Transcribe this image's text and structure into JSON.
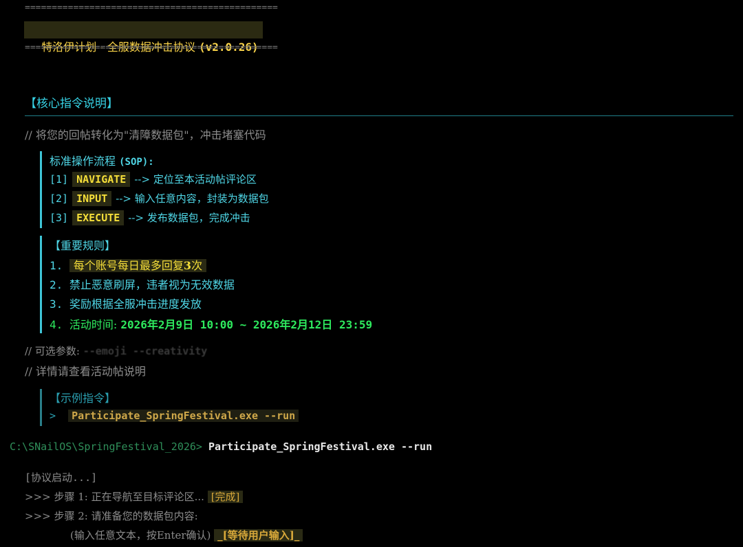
{
  "header": {
    "separator": "===============================================",
    "title_prefix": "特洛伊计划 - 全服数据冲击协议 ",
    "title_version": "(v2.0.26)"
  },
  "core": {
    "heading": "【核心指令说明】",
    "comment": "// 将您的回帖转化为\"清障数据包\"，冲击堵塞代码",
    "sop_title": "标准操作流程 ",
    "sop_tag": "(SOP):",
    "steps": [
      {
        "num": "[1]",
        "kw": "NAVIGATE",
        "desc": "--> 定位至本活动帖评论区"
      },
      {
        "num": "[2]",
        "kw": "INPUT",
        "desc": "--> 输入任意内容，封装为数据包"
      },
      {
        "num": "[3]",
        "kw": "EXECUTE",
        "desc": "--> 发布数据包，完成冲击"
      }
    ]
  },
  "rules": {
    "heading": "【重要规则】",
    "items": [
      {
        "num": "1.",
        "text_a": "每个账号每日最多回复",
        "text_b": "3",
        "text_c": "次"
      },
      {
        "num": "2.",
        "text": "禁止恶意刷屏，违者视为无效数据"
      },
      {
        "num": "3.",
        "text": "奖励根据全服冲击进度发放"
      },
      {
        "num": "4.",
        "label": "活动时间: ",
        "time": "2026年2月9日 10:00 ~ 2026年2月12日 23:59"
      }
    ]
  },
  "optional": {
    "comment_label": "// 可选参数: ",
    "params": "--emoji --creativity",
    "detail": "// 详情请查看活动帖说明"
  },
  "example": {
    "heading": "【示例指令】",
    "arrow": ">",
    "command": "Participate_SpringFestival.exe --run"
  },
  "terminal": {
    "prompt": "C:\\SNailOS\\SpringFestival_2026>",
    "command": "Participate_SpringFestival.exe --run",
    "line1": "[协议启动...]",
    "line2_prefix": ">>> 步骤 1: 正在导航至目标评论区... ",
    "line2_tag": "[完成]",
    "line3": ">>> 步骤 2: 请准备您的数据包内容:",
    "line4_prefix": "(输入任意文本，按Enter确认) ",
    "line4_tag": "_[等待用户输入]_"
  },
  "colors": {
    "background": "#000000",
    "cyan": "#4fd6e6",
    "yellow": "#f5de39",
    "green": "#2eea5e"
  }
}
